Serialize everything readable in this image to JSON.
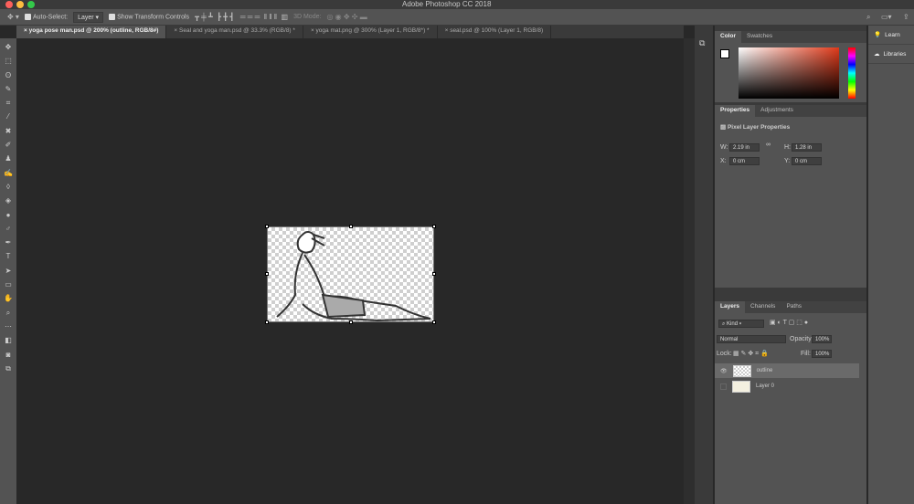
{
  "app_title": "Adobe Photoshop CC 2018",
  "options": {
    "auto_select_label": "Auto-Select:",
    "auto_select_value": "Layer",
    "transform_label": "Show Transform Controls",
    "mode_3d": "3D Mode:"
  },
  "tabs": [
    {
      "label": "yoga pose man.psd @ 200% (outline, RGB/8#)"
    },
    {
      "label": "Seal and yoga man.psd @ 33.3% (RGB/8) *"
    },
    {
      "label": "yoga mat.png @ 300% (Layer 1, RGB/8*) *"
    },
    {
      "label": "seal.psd @ 100% (Layer 1, RGB/8)"
    }
  ],
  "color_panel": {
    "tabs": [
      "Color",
      "Swatches"
    ]
  },
  "properties": {
    "tabs": [
      "Properties",
      "Adjustments"
    ],
    "title": "Pixel Layer Properties",
    "w_label": "W:",
    "w": "2.19 in",
    "h_label": "H:",
    "h": "1.28 in",
    "x_label": "X:",
    "x": "0 cm",
    "y_label": "Y:",
    "y": "0 cm"
  },
  "layers_panel": {
    "tabs": [
      "Layers",
      "Channels",
      "Paths"
    ],
    "filter": "Kind",
    "blend": "Normal",
    "opacity_label": "Opacity:",
    "opacity": "100%",
    "lock_label": "Lock:",
    "fill_label": "Fill:",
    "fill": "100%",
    "layers": [
      {
        "name": "outline",
        "visible": true
      },
      {
        "name": "Layer 0",
        "visible": false
      }
    ]
  },
  "right_panel": {
    "learn": "Learn",
    "libraries": "Libraries"
  }
}
